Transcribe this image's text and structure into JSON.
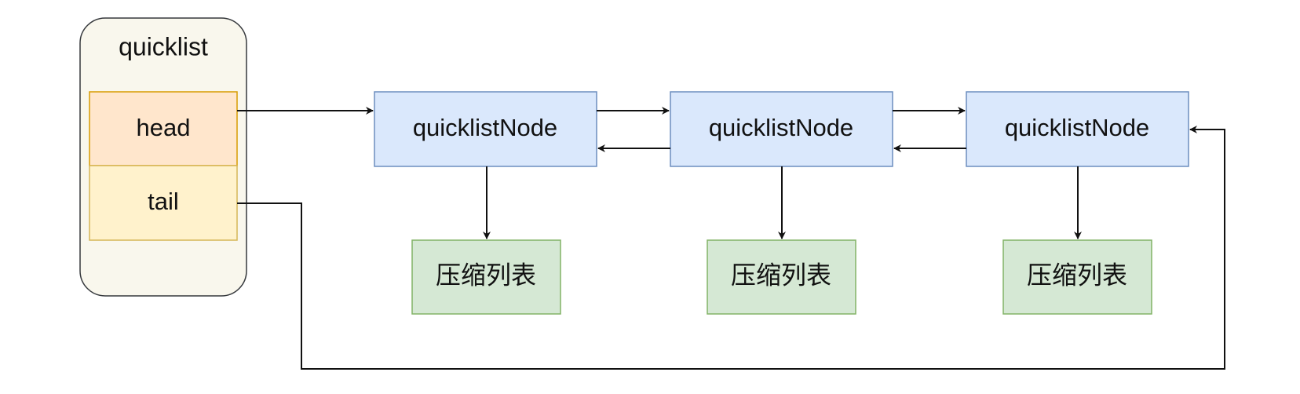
{
  "quicklist": {
    "title": "quicklist",
    "fields": [
      "head",
      "tail"
    ]
  },
  "nodes": [
    {
      "label": "quicklistNode",
      "ziplist": "压缩列表"
    },
    {
      "label": "quicklistNode",
      "ziplist": "压缩列表"
    },
    {
      "label": "quicklistNode",
      "ziplist": "压缩列表"
    }
  ],
  "colors": {
    "quicklist_fill": "#f9f7ed",
    "quicklist_stroke": "#36393d",
    "head_fill": "#ffe6cc",
    "head_stroke": "#d79b00",
    "tail_fill": "#fff2cc",
    "tail_stroke": "#d6b656",
    "node_fill": "#dae8fc",
    "node_stroke": "#6c8ebf",
    "ziplist_fill": "#d5e8d4",
    "ziplist_stroke": "#82b366",
    "edge": "#111111"
  }
}
